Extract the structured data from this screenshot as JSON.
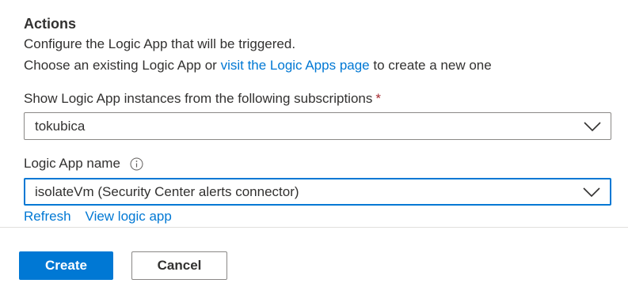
{
  "actions": {
    "heading": "Actions",
    "description_line1": "Configure the Logic App that will be triggered.",
    "description_line2_prefix": "Choose an existing Logic App or ",
    "description_line2_link": "visit the Logic Apps page",
    "description_line2_suffix": " to create a new one"
  },
  "subscriptions": {
    "label": "Show Logic App instances from the following subscriptions",
    "required_marker": "*",
    "selected_value": "tokubica",
    "icon": "chevron-down-icon"
  },
  "logic_app": {
    "label": "Logic App name",
    "info_icon": "info-icon",
    "selected_value": "isolateVm (Security Center alerts connector)",
    "icon": "chevron-down-icon"
  },
  "links": {
    "refresh": "Refresh",
    "view": "View logic app"
  },
  "footer": {
    "create_label": "Create",
    "cancel_label": "Cancel"
  },
  "colors": {
    "accent": "#0078d4",
    "required": "#a4262c",
    "text": "#323130",
    "border": "#8a8886"
  }
}
